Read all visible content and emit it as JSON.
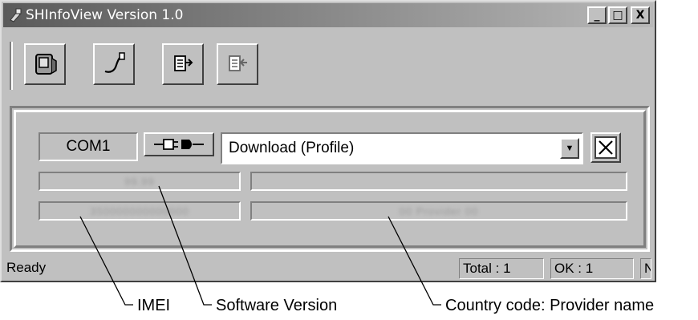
{
  "window": {
    "title": "SHInfoView Version 1.0",
    "minimize": "_",
    "maximize": "□",
    "close": "X"
  },
  "toolbar": {
    "buttons": [
      {
        "name": "phone-info-icon"
      },
      {
        "name": "connect-cable-icon"
      },
      {
        "name": "export-icon"
      },
      {
        "name": "import-icon"
      }
    ]
  },
  "connection": {
    "port": "COM1",
    "mode": "Download (Profile)",
    "dropdown_arrow": "▼"
  },
  "info": {
    "software_version": "99.99",
    "imei": "350000000000000",
    "country_provider": "00 Provider 00"
  },
  "status": {
    "text": "Ready",
    "total": "Total : 1",
    "ok": "OK : 1",
    "extra": "N"
  },
  "annotations": {
    "imei": "IMEI",
    "software_version": "Software Version",
    "country_provider": "Country code: Provider name"
  }
}
